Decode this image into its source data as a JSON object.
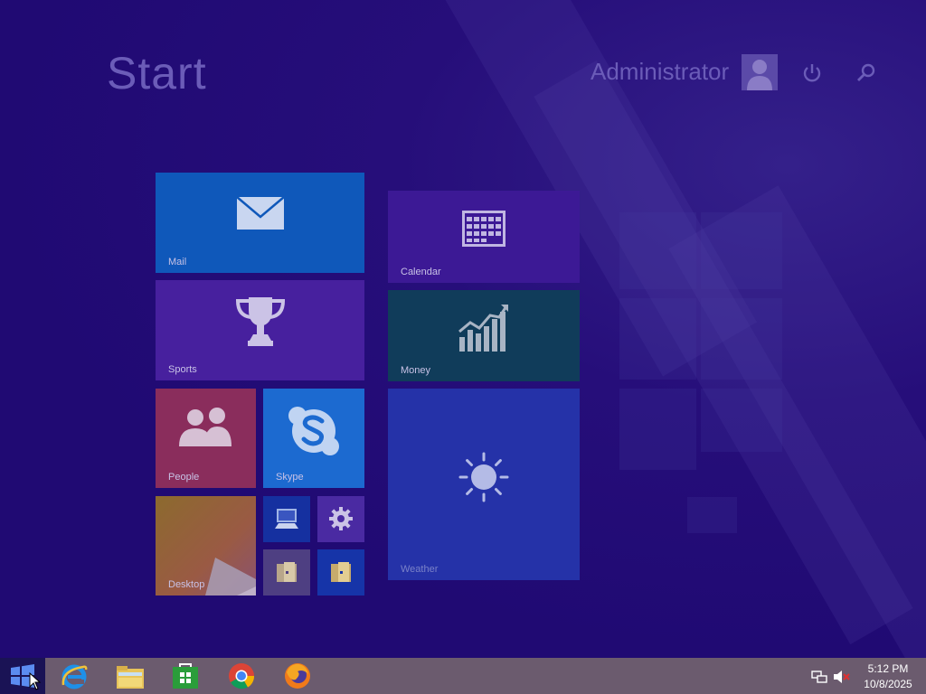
{
  "start": {
    "title": "Start",
    "user_name": "Administrator",
    "power_icon": "power-icon",
    "search_icon": "search-icon"
  },
  "tiles": {
    "mail": {
      "label": "Mail",
      "icon": "mail-icon",
      "color": "#0f58ba"
    },
    "calendar": {
      "label": "Calendar",
      "icon": "calendar-icon",
      "color": "#3c1995"
    },
    "sports": {
      "label": "Sports",
      "icon": "trophy-icon",
      "color": "#47209e"
    },
    "money": {
      "label": "Money",
      "icon": "stock-chart-icon",
      "color": "#103c5a"
    },
    "people": {
      "label": "People",
      "icon": "people-icon",
      "color": "#8a2d5c"
    },
    "skype": {
      "label": "Skype",
      "icon": "skype-icon",
      "color": "#1c6ad0"
    },
    "weather": {
      "label": "Weather",
      "icon": "sun-icon",
      "color": "#2532a8"
    },
    "desktop": {
      "label": "Desktop",
      "icon": "desktop-wallpaper",
      "color": "#8c5a58"
    },
    "small": [
      {
        "name": "this-pc",
        "icon": "computer-icon",
        "color": "#1530a0"
      },
      {
        "name": "pc-settings",
        "icon": "gear-icon",
        "color": "#4a2aa2"
      },
      {
        "name": "file-explorer-a",
        "icon": "folder-icon",
        "color": "#4e3f82"
      },
      {
        "name": "file-explorer-b",
        "icon": "folder-icon",
        "color": "#1634a8"
      }
    ]
  },
  "taskbar": {
    "items": [
      "windows-logo-icon",
      "internet-explorer-icon",
      "file-explorer-icon",
      "store-icon",
      "chrome-icon",
      "firefox-icon"
    ],
    "tray": [
      "network-icon",
      "volume-muted-icon"
    ],
    "time": "5:12 PM",
    "date": "10/8/2025"
  }
}
